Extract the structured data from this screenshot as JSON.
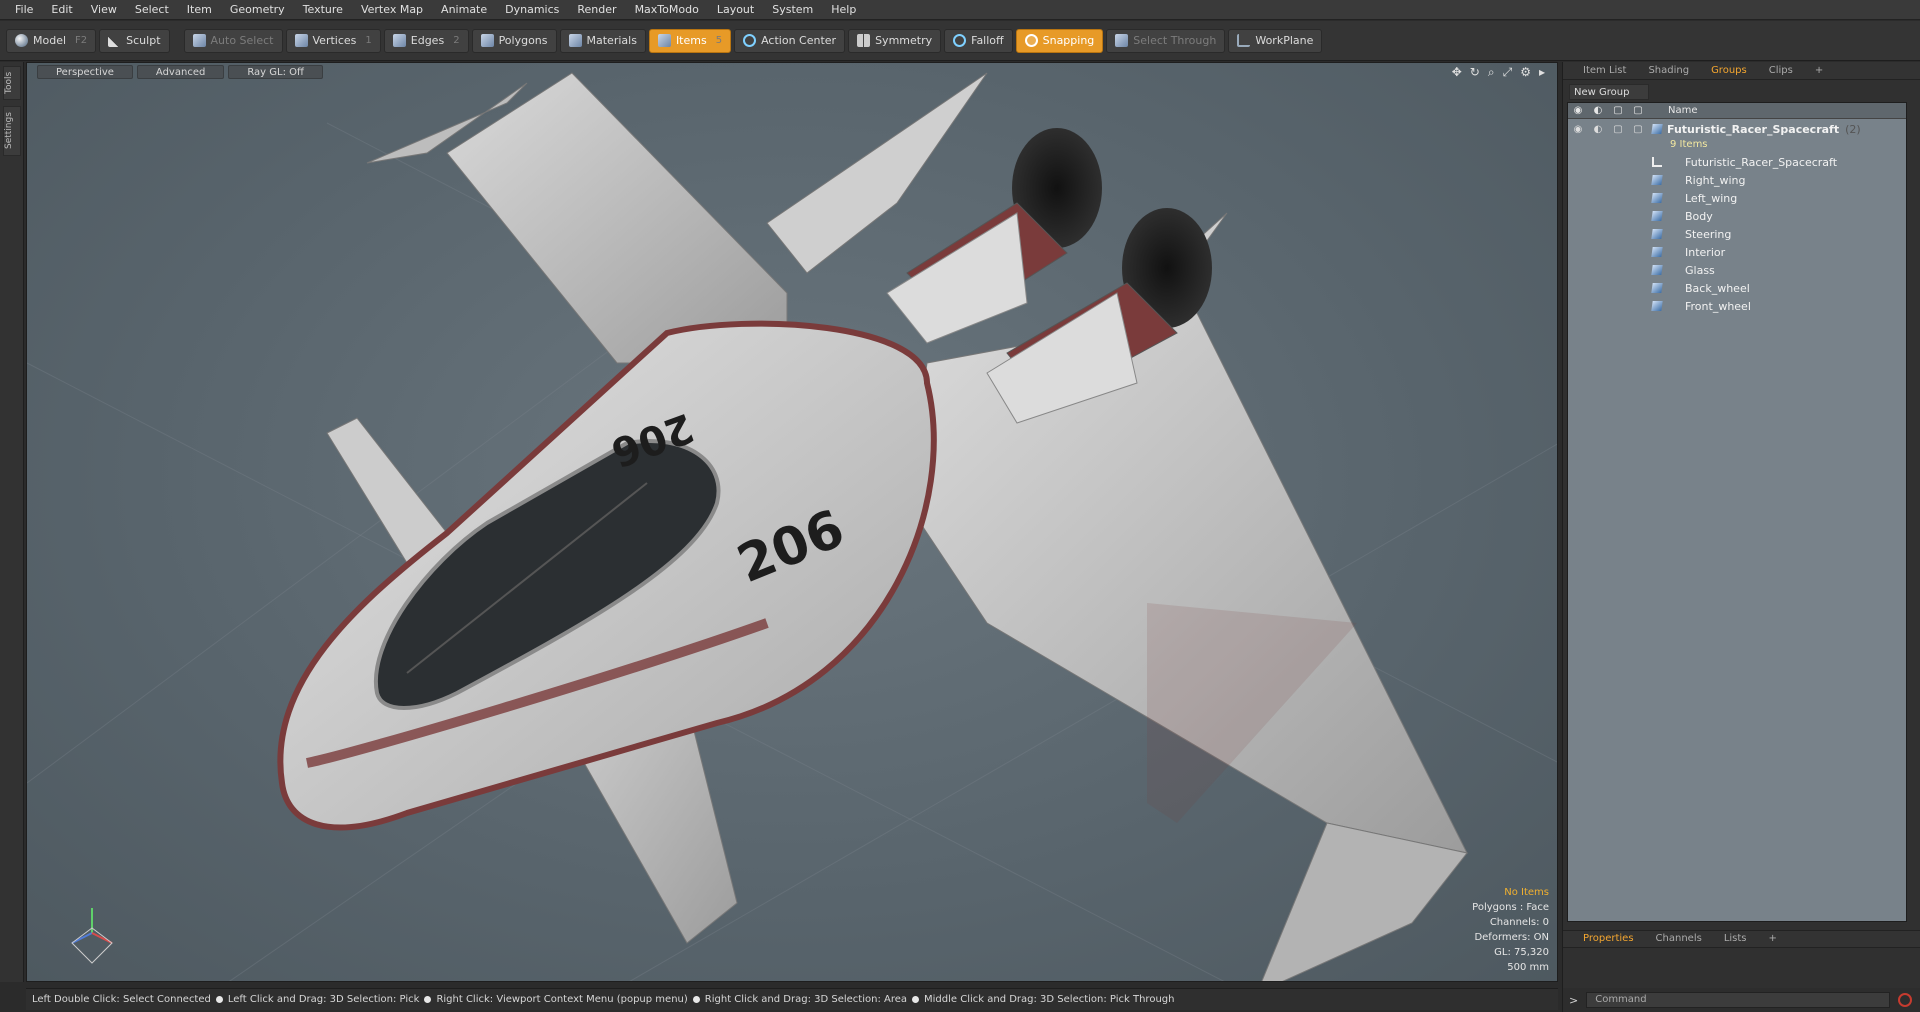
{
  "menu": [
    "File",
    "Edit",
    "View",
    "Select",
    "Item",
    "Geometry",
    "Texture",
    "Vertex Map",
    "Animate",
    "Dynamics",
    "Render",
    "MaxToModo",
    "Layout",
    "System",
    "Help"
  ],
  "toolbar": {
    "model": "Model",
    "model_key": "F2",
    "sculpt": "Sculpt",
    "auto_select": "Auto Select",
    "vertices": "Vertices",
    "vertices_key": "1",
    "edges": "Edges",
    "edges_key": "2",
    "polygons": "Polygons",
    "materials": "Materials",
    "items": "Items",
    "items_key": "5",
    "action_center": "Action Center",
    "symmetry": "Symmetry",
    "falloff": "Falloff",
    "snapping": "Snapping",
    "select_through": "Select Through",
    "workplane": "WorkPlane"
  },
  "left_tabs": [
    "Tools",
    "Settings"
  ],
  "viewport": {
    "view": "Perspective",
    "mode": "Advanced",
    "raygl": "Ray GL: Off",
    "info": {
      "items": "No Items",
      "polygons": "Polygons : Face",
      "channels": "Channels: 0",
      "deformers": "Deformers: ON",
      "gl": "GL: 75,320",
      "scale": "500 mm"
    },
    "decal_number": "206",
    "accent_color": "#7a3b3b"
  },
  "status": [
    "Left Double Click: Select Connected",
    "Left Click and Drag: 3D Selection: Pick",
    "Right Click: Viewport Context Menu (popup menu)",
    "Right Click and Drag: 3D Selection: Area",
    "Middle Click and Drag: 3D Selection: Pick Through"
  ],
  "right_panel": {
    "tabs": [
      "Item List",
      "Shading",
      "Groups",
      "Clips"
    ],
    "active_tab": "Groups",
    "new_group": "New Group",
    "column_name": "Name",
    "group": {
      "name": "Futuristic_Racer_Spacecraft",
      "count": "(2)",
      "items_label": "9 Items",
      "children": [
        "Futuristic_Racer_Spacecraft",
        "Right_wing",
        "Left_wing",
        "Body",
        "Steering",
        "Interior",
        "Glass",
        "Back_wheel",
        "Front_wheel"
      ]
    },
    "bottom_tabs": [
      "Properties",
      "Channels",
      "Lists"
    ],
    "bottom_active": "Properties",
    "command_placeholder": "Command"
  },
  "colors": {
    "active_orange": "#e79a27",
    "viewport_bg": "#5f6b73"
  }
}
